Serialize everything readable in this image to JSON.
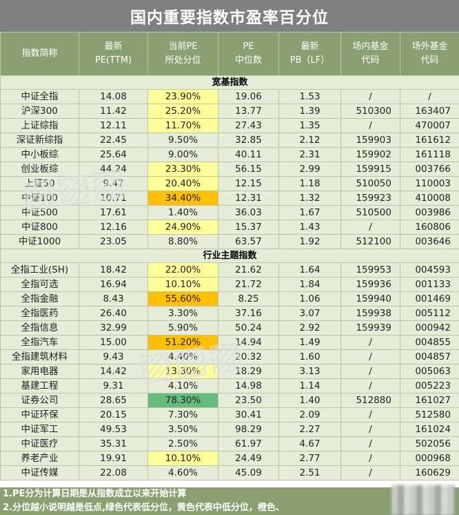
{
  "title": "国内重要指数市盈率百分位",
  "headers": [
    "指数简称",
    "最新\nPE(TTM)",
    "当前PE\n所处分位",
    "PE\n中位数",
    "最新\nPB（LF）",
    "场内基金\n代码",
    "场外基金\n代码"
  ],
  "sections": [
    {
      "label": "宽基指数",
      "rows": [
        {
          "name": "中证全指",
          "pe": "14.08",
          "pct": "23.90%",
          "tone": "y",
          "median": "19.06",
          "pb": "1.53",
          "inside": "/",
          "outside": "/"
        },
        {
          "name": "沪深300",
          "pe": "11.42",
          "pct": "25.20%",
          "tone": "y",
          "median": "13.77",
          "pb": "1.39",
          "inside": "510300",
          "outside": "163407"
        },
        {
          "name": "上证综指",
          "pe": "12.11",
          "pct": "11.70%",
          "tone": "y",
          "median": "27.43",
          "pb": "1.35",
          "inside": "/",
          "outside": "470007"
        },
        {
          "name": "深证新综指",
          "pe": "22.45",
          "pct": "9.50%",
          "tone": "",
          "median": "32.85",
          "pb": "2.12",
          "inside": "159903",
          "outside": "161612"
        },
        {
          "name": "中小板综",
          "pe": "25.64",
          "pct": "9.00%",
          "tone": "",
          "median": "40.11",
          "pb": "2.31",
          "inside": "159902",
          "outside": "161118"
        },
        {
          "name": "创业板综",
          "pe": "44.24",
          "pct": "23.30%",
          "tone": "y",
          "median": "56.15",
          "pb": "2.99",
          "inside": "159915",
          "outside": "003766"
        },
        {
          "name": "上证50",
          "pe": "9.47",
          "pct": "20.40%",
          "tone": "y",
          "median": "12.15",
          "pb": "1.18",
          "inside": "510050",
          "outside": "110003"
        },
        {
          "name": "中证100",
          "pe": "10.71",
          "pct": "34.40%",
          "tone": "o",
          "median": "12.31",
          "pb": "1.32",
          "inside": "159923",
          "outside": "410008"
        },
        {
          "name": "中证500",
          "pe": "17.61",
          "pct": "1.40%",
          "tone": "",
          "median": "36.03",
          "pb": "1.67",
          "inside": "510500",
          "outside": "003986"
        },
        {
          "name": "中证800",
          "pe": "12.16",
          "pct": "24.90%",
          "tone": "y",
          "median": "15.37",
          "pb": "1.43",
          "inside": "/",
          "outside": "160806"
        },
        {
          "name": "中证1000",
          "pe": "23.05",
          "pct": "8.80%",
          "tone": "",
          "median": "63.57",
          "pb": "1.92",
          "inside": "512100",
          "outside": "003646"
        }
      ]
    },
    {
      "label": "行业主题指数",
      "rows": [
        {
          "name": "全指工业(SH)",
          "pe": "18.42",
          "pct": "22.00%",
          "tone": "y",
          "median": "21.62",
          "pb": "1.64",
          "inside": "159953",
          "outside": "004593"
        },
        {
          "name": "全指可选",
          "pe": "16.94",
          "pct": "10.10%",
          "tone": "y",
          "median": "21.72",
          "pb": "1.84",
          "inside": "159936",
          "outside": "001133"
        },
        {
          "name": "全指金融",
          "pe": "8.43",
          "pct": "55.60%",
          "tone": "o",
          "median": "8.25",
          "pb": "1.06",
          "inside": "159940",
          "outside": "001469"
        },
        {
          "name": "全指医药",
          "pe": "26.40",
          "pct": "3.30%",
          "tone": "",
          "median": "37.16",
          "pb": "3.07",
          "inside": "159938",
          "outside": "005112"
        },
        {
          "name": "全指信息",
          "pe": "32.99",
          "pct": "5.90%",
          "tone": "",
          "median": "50.24",
          "pb": "2.92",
          "inside": "159939",
          "outside": "000942"
        },
        {
          "name": "全指汽车",
          "pe": "15.00",
          "pct": "51.20%",
          "tone": "o",
          "median": "14.94",
          "pb": "1.49",
          "inside": "/",
          "outside": "004855"
        },
        {
          "name": "全指建筑材料",
          "pe": "9.43",
          "pct": "4.40%",
          "tone": "",
          "median": "20.32",
          "pb": "1.60",
          "inside": "/",
          "outside": "004857"
        },
        {
          "name": "家用电器",
          "pe": "14.42",
          "pct": "13.30%",
          "tone": "y",
          "median": "18.29",
          "pb": "3.13",
          "inside": "/",
          "outside": "005063"
        },
        {
          "name": "基建工程",
          "pe": "9.31",
          "pct": "4.10%",
          "tone": "",
          "median": "14.98",
          "pb": "1.14",
          "inside": "/",
          "outside": "005223"
        },
        {
          "name": "证券公司",
          "pe": "28.65",
          "pct": "78.30%",
          "tone": "g",
          "median": "23.50",
          "pb": "1.40",
          "inside": "512880",
          "outside": "161027"
        },
        {
          "name": "中证环保",
          "pe": "20.15",
          "pct": "7.30%",
          "tone": "",
          "median": "30.41",
          "pb": "2.09",
          "inside": "/",
          "outside": "512580"
        },
        {
          "name": "中证军工",
          "pe": "49.53",
          "pct": "3.50%",
          "tone": "",
          "median": "98.29",
          "pb": "2.27",
          "inside": "/",
          "outside": "161024"
        },
        {
          "name": "中证医疗",
          "pe": "35.31",
          "pct": "2.50%",
          "tone": "",
          "median": "61.97",
          "pb": "4.67",
          "inside": "/",
          "outside": "502056"
        },
        {
          "name": "养老产业",
          "pe": "19.91",
          "pct": "10.10%",
          "tone": "y",
          "median": "24.49",
          "pb": "2.77",
          "inside": "/",
          "outside": "000968"
        },
        {
          "name": "中证传媒",
          "pe": "22.08",
          "pct": "4.60%",
          "tone": "",
          "median": "45.09",
          "pb": "2.51",
          "inside": "/",
          "outside": "160629"
        }
      ]
    }
  ],
  "notes": [
    "1.PE分为计算日期是从指数成立以来开始计算",
    "2.分位越小说明越是低点,绿色代表低分位，黄色代表中低分位，橙色、"
  ]
}
